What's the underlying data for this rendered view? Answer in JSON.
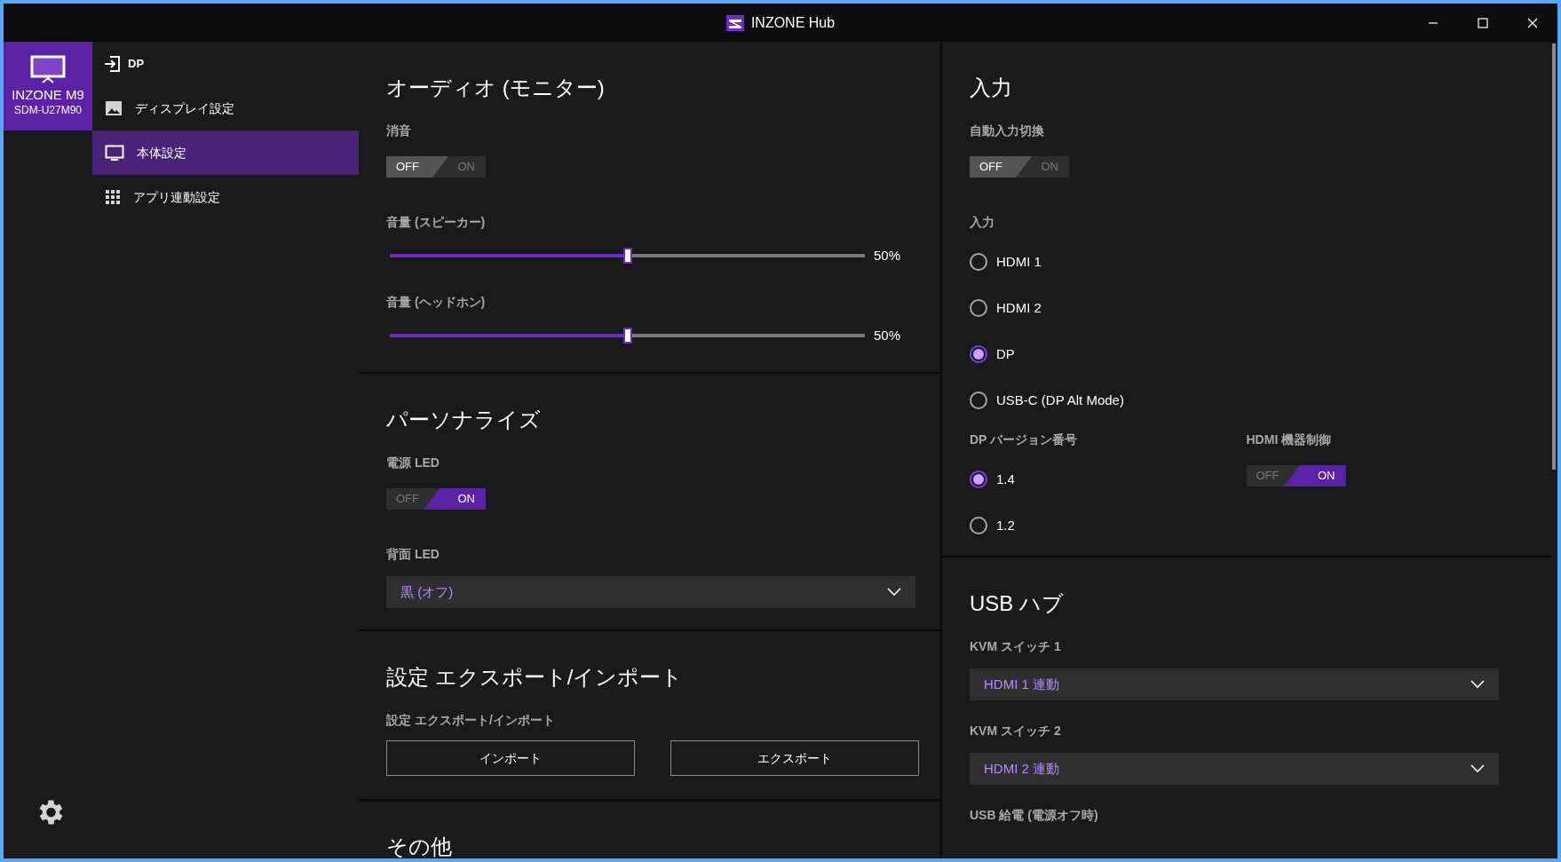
{
  "window": {
    "title": "INZONE Hub"
  },
  "device": {
    "name": "INZONE M9",
    "model": "SDM-U27M90"
  },
  "nav": {
    "input": "DP",
    "items": [
      {
        "label": "ディスプレイ設定",
        "selected": false
      },
      {
        "label": "本体設定",
        "selected": true
      },
      {
        "label": "アプリ連動設定",
        "selected": false
      }
    ]
  },
  "left_sections": [
    {
      "title": "オーディオ (モニター)",
      "controls": [
        {
          "kind": "toggle",
          "label": "消音",
          "off_label": "OFF",
          "on_label": "ON",
          "on": false
        },
        {
          "kind": "slider",
          "label": "音量 (スピーカー)",
          "level": 0.5,
          "reading": "50%"
        },
        {
          "kind": "slider",
          "label": "音量 (ヘッドホン)",
          "level": 0.5,
          "reading": "50%"
        }
      ]
    },
    {
      "title": "パーソナライズ",
      "controls": [
        {
          "kind": "toggle",
          "label": "電源 LED",
          "off_label": "OFF",
          "on_label": "ON",
          "on": true
        },
        {
          "kind": "dropdown",
          "label": "背面 LED",
          "value": "黒 (オフ)"
        }
      ]
    },
    {
      "title": "設定 エクスポート/インポート",
      "controls": [
        {
          "kind": "buttons",
          "label": "設定 エクスポート/インポート",
          "buttons": [
            "インポート",
            "エクスポート"
          ]
        }
      ]
    },
    {
      "title": "その他"
    }
  ],
  "right_sections": [
    {
      "title": "入力",
      "controls": [
        {
          "kind": "toggle",
          "label": "自動入力切換",
          "off_label": "OFF",
          "on_label": "ON",
          "on": false
        },
        {
          "kind": "radio",
          "label": "入力",
          "options": [
            {
              "label": "HDMI 1",
              "selected": false
            },
            {
              "label": "HDMI 2",
              "selected": false
            },
            {
              "label": "DP",
              "selected": true
            },
            {
              "label": "USB-C (DP Alt Mode)",
              "selected": false
            }
          ]
        },
        {
          "kind": "columns",
          "columns": [
            {
              "kind": "radio",
              "label": "DP バージョン番号",
              "options": [
                {
                  "label": "1.4",
                  "selected": true
                },
                {
                  "label": "1.2",
                  "selected": false
                }
              ]
            },
            {
              "kind": "toggle",
              "label": "HDMI 機器制御",
              "off_label": "OFF",
              "on_label": "ON",
              "on": true
            }
          ]
        }
      ]
    },
    {
      "title": "USB ハブ",
      "controls": [
        {
          "kind": "dropdown",
          "label": "KVM スイッチ 1",
          "value": "HDMI 1 連動"
        },
        {
          "kind": "dropdown",
          "label": "KVM スイッチ 2",
          "value": "HDMI 2 連動"
        },
        {
          "kind": "label",
          "label": "USB 給電 (電源オフ時)"
        }
      ]
    }
  ]
}
